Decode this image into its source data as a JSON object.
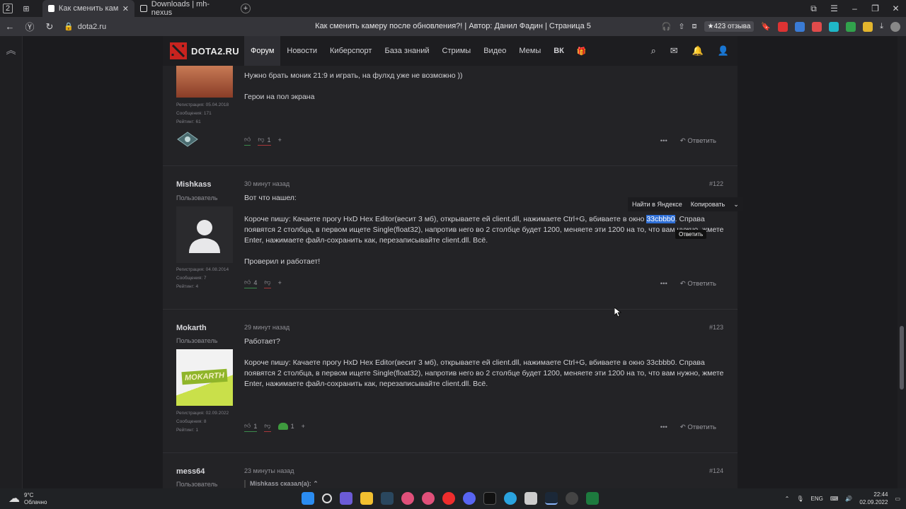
{
  "browser": {
    "tab_count": "2",
    "tabs": [
      {
        "label": "Как сменить камеру по"
      },
      {
        "label": "Downloads | mh-nexus"
      }
    ],
    "url": "dota2.ru",
    "page_title": "Как сменить камеру после обновления?! | Автор: Данил Фадин | Страница 5",
    "reviews_badge": "★423 отзыва"
  },
  "site": {
    "logo_text": "DOTA2.RU",
    "nav": [
      "Форум",
      "Новости",
      "Киберспорт",
      "База знаний",
      "Стримы",
      "Видео",
      "Мемы"
    ],
    "active_nav": "Форум"
  },
  "posts": [
    {
      "text": [
        "Нужно брать  моник 21:9 и играть, на фулхд  уже не возможно ))",
        "Герои на пол экрана"
      ],
      "stats": [
        "Регистрация: 05.04.2018",
        "Сообщения: 171",
        "Рейтинг: 61"
      ],
      "dislikes": "1",
      "reply": "Ответить"
    },
    {
      "username": "Mishkass",
      "role": "Пользователь",
      "time": "30 минут назад",
      "number": "#122",
      "line1": "Вот что нашел:",
      "body_before": "Короче пишу: Качаете прогу HxD Hex Editor(весит 3 мб), открываете ей client.dll, нажимаете Ctrl+G, вбиваете в окно ",
      "body_selected": "33cbbb0",
      "body_after": ". Справа появятся 2 столбца, в первом ищете Single(float32), напротив него во 2 столбце будет 1200, меняете эти 1200 на то, что вам нужно, жмете Enter, нажимаете файл-сохранить как, перезаписывайте client.dll. Всё.",
      "line3": "Проверил и работает!",
      "stats": [
        "Регистрация: 04.08.2014",
        "Сообщения: 7",
        "Рейтинг: 4"
      ],
      "likes": "4",
      "reply": "Ответить"
    },
    {
      "username": "Mokarth",
      "role": "Пользователь",
      "time": "29 минут назад",
      "number": "#123",
      "line1": "Работает?",
      "body": "Короче пишу: Качаете прогу HxD Hex Editor(весит 3 мб), открываете ей client.dll, нажимаете Ctrl+G, вбиваете в окно 33cbbb0. Справа появятся 2 столбца, в первом ищете Single(float32), напротив него во 2 столбце будет 1200, меняете эти 1200 на то, что вам нужно, жмете Enter, нажимаете файл-сохранить как, перезаписывайте client.dll. Всё.",
      "avatar_text": "MOKARTH",
      "stats": [
        "Регистрация: 02.09.2022",
        "Сообщения: 8",
        "Рейтинг: 1"
      ],
      "likes": "1",
      "reaction_count": "1",
      "reply": "Ответить"
    },
    {
      "username": "mess64",
      "role": "Пользователь",
      "time": "23 минуты назад",
      "number": "#124",
      "quote_author": "Mishkass сказал(а):"
    }
  ],
  "context_menu": {
    "search": "Найти в Яндексе",
    "copy": "Копировать",
    "tooltip": "Ответить"
  },
  "taskbar": {
    "temp": "9°C",
    "weather": "Облачно",
    "lang": "ENG",
    "time": "22:44",
    "date": "02.09.2022"
  }
}
